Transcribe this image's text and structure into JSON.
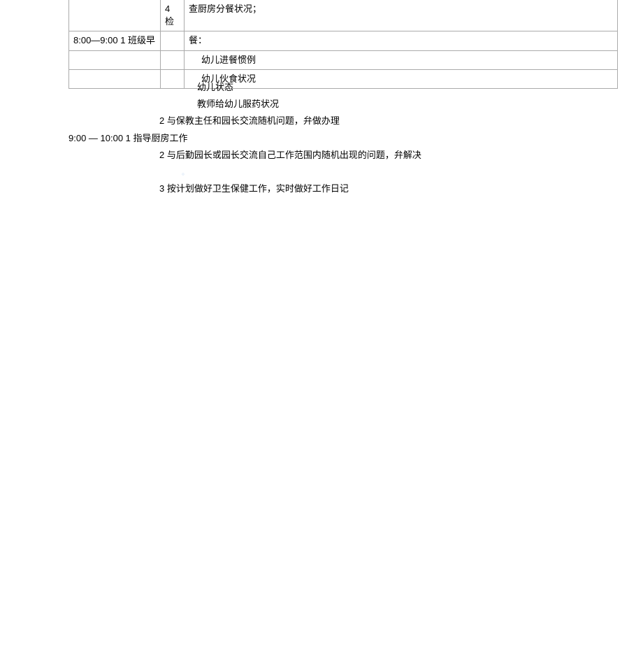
{
  "tbl": {
    "r0": {
      "time": "",
      "num": "4 检",
      "body": "查厨房分餐状况；"
    },
    "r1": {
      "time": "8:00—9:00 1 班级早",
      "num": "",
      "body": "餐："
    },
    "r2": {
      "time": "",
      "num": "",
      "body": "幼儿进餐惯例"
    },
    "r3": {
      "time": "",
      "num": "",
      "body": "幼儿伙食状况"
    }
  },
  "below": {
    "l0": "幼儿状态",
    "l1": "教师给幼儿服药状况",
    "l2": "2 与保教主任和园长交流随机问题，弁做办理",
    "l3time": "9:00 — 10:00 1 指导厨房工作",
    "l4": "2 与后勤园长或园长交流自己工作范围内随机出现的问题，弁解决",
    "dot": "。",
    "l5": "3 按计划做好卫生保健工作，实时做好工作日记"
  }
}
